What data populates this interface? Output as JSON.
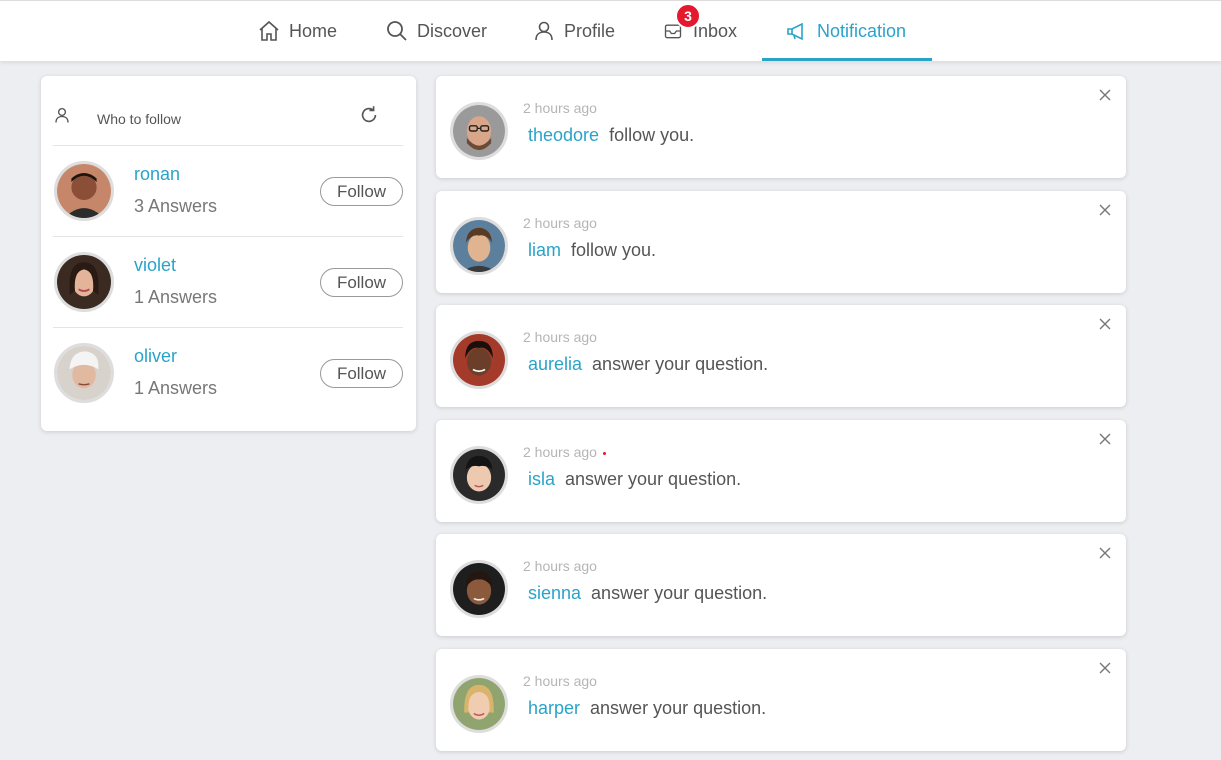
{
  "nav": {
    "items": [
      {
        "label": "Home",
        "icon": "home-icon"
      },
      {
        "label": "Discover",
        "icon": "search-icon"
      },
      {
        "label": "Profile",
        "icon": "user-icon"
      },
      {
        "label": "Inbox",
        "icon": "inbox-icon"
      },
      {
        "label": "Notification",
        "icon": "megaphone-icon"
      }
    ],
    "active": "Notification",
    "inbox_badge": "3",
    "accent_color": "#2aa3c9",
    "badge_color": "#e5192d"
  },
  "who_to_follow": {
    "title": "Who to follow",
    "suggestions": [
      {
        "name": "ronan",
        "answers": "3 Answers",
        "button": "Follow"
      },
      {
        "name": "violet",
        "answers": "1 Answers",
        "button": "Follow"
      },
      {
        "name": "oliver",
        "answers": "1 Answers",
        "button": "Follow"
      }
    ]
  },
  "notifications": [
    {
      "time": "2 hours ago",
      "user": "theodore",
      "text": "follow you."
    },
    {
      "time": "2 hours ago",
      "user": "liam",
      "text": "follow you."
    },
    {
      "time": "2 hours ago",
      "user": "aurelia",
      "text": "answer your question."
    },
    {
      "time": "2 hours ago",
      "user": "isla",
      "text": "answer your question."
    },
    {
      "time": "2 hours ago",
      "user": "sienna",
      "text": "answer your question."
    },
    {
      "time": "2 hours ago",
      "user": "harper",
      "text": "answer your question."
    }
  ],
  "close_glyph": "X"
}
